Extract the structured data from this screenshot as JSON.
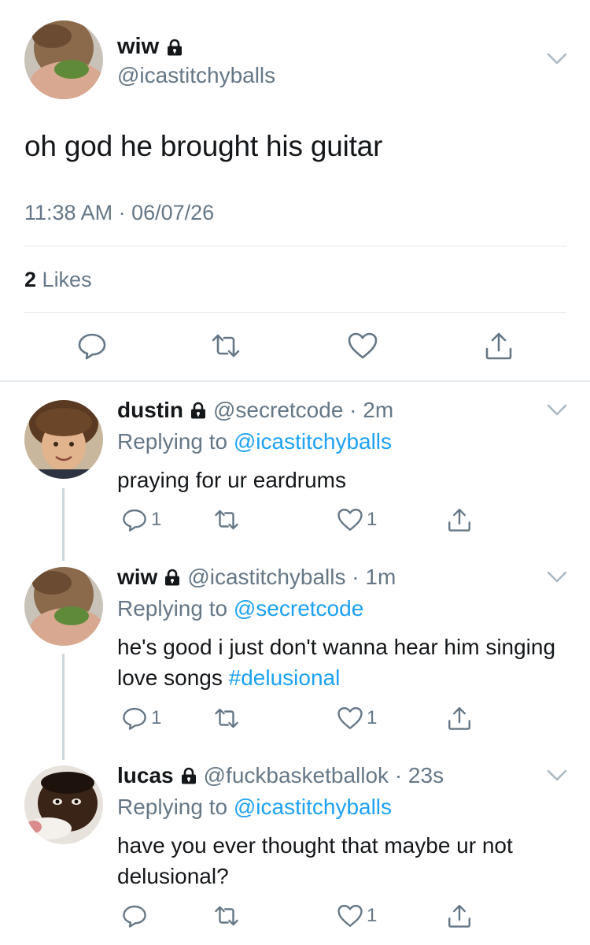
{
  "main_tweet": {
    "name": "wiw",
    "handle": "@icastitchyballs",
    "text": "oh god he brought his guitar",
    "timestamp": "11:38 AM · 06/07/26",
    "likes_count": "2",
    "likes_label": "Likes",
    "icons": [
      "reply-icon",
      "retweet-icon",
      "like-icon",
      "share-icon"
    ]
  },
  "replies": [
    {
      "name": "dustin",
      "handle": "@secretcode · 2m",
      "replying_prefix": "Replying to",
      "replying_to": "@icastitchyballs",
      "text": "praying for ur eardrums",
      "hashtag": "",
      "reply_count": "1",
      "like_count": "1"
    },
    {
      "name": "wiw",
      "handle": "@icastitchyballs · 1m",
      "replying_prefix": "Replying to",
      "replying_to": "@secretcode",
      "text": "he's good i just don't wanna hear him singing love songs ",
      "hashtag": "#delusional",
      "reply_count": "1",
      "like_count": "1"
    },
    {
      "name": "lucas",
      "handle": "@fuckbasketballok · 23s",
      "replying_prefix": "Replying to",
      "replying_to": "@icastitchyballs",
      "text": "have you ever thought that maybe ur not delusional?",
      "hashtag": "",
      "reply_count": "",
      "like_count": "1"
    }
  ],
  "colors": {
    "link": "#1da1f2",
    "secondary_text": "#657786",
    "primary_text": "#14171a",
    "divider": "#e1e8ed"
  }
}
